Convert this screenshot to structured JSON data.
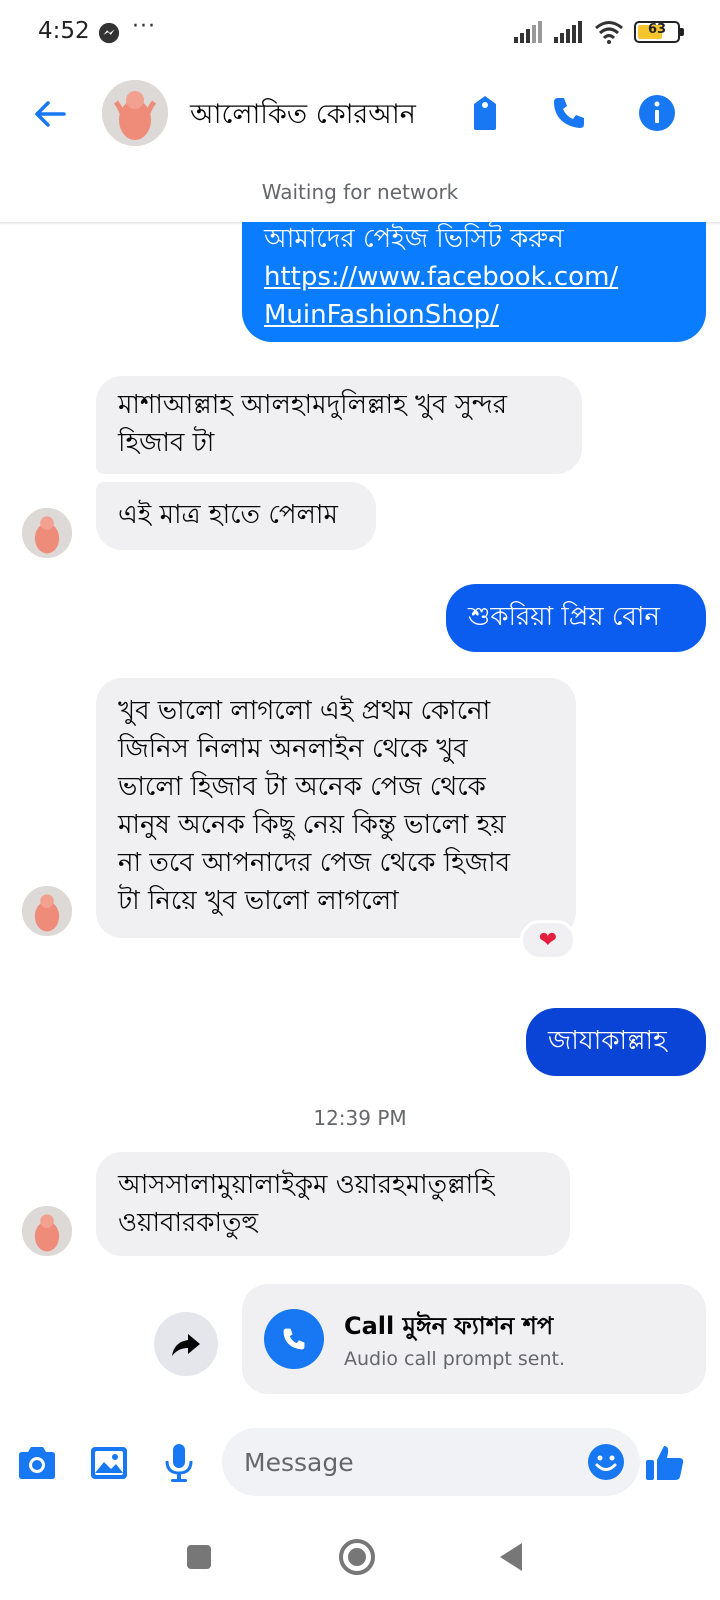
{
  "status_bar": {
    "time": "4:52",
    "dots": "···",
    "battery": "63"
  },
  "header": {
    "title": "আলোকিত কোরআন",
    "network_status": "Waiting for network"
  },
  "messages": [
    {
      "direction": "outgoing",
      "lines": [
        "আমাদের পেইজ ভিসিট করুন"
      ],
      "link_lines": [
        "https://www.facebook.com/",
        "MuinFashionShop/"
      ]
    },
    {
      "direction": "incoming",
      "lines": [
        "মাশাআল্লাহ আলহামদুলিল্লাহ খুব সুন্দর",
        "হিজাব টা"
      ]
    },
    {
      "direction": "incoming",
      "lines": [
        "এই মাত্র হাতে পেলাম"
      ]
    },
    {
      "direction": "outgoing",
      "lines": [
        "শুকরিয়া প্রিয় বোন"
      ]
    },
    {
      "direction": "incoming",
      "lines": [
        "খুব ভালো লাগলো এই প্রথম কোনো",
        "জিনিস নিলাম অনলাইন থেকে খুব",
        "ভালো হিজাব টা অনেক পেজ থেকে",
        "মানুষ অনেক কিছু নেয় কিন্তু ভালো হয়",
        "না তবে আপনাদের পেজ থেকে হিজাব",
        "টা নিয়ে খুব ভালো লাগলো"
      ],
      "reaction": "heart"
    },
    {
      "direction": "outgoing",
      "lines": [
        "জাযাকাল্লাহ"
      ]
    },
    {
      "direction": "incoming",
      "lines": [
        "আসসালামুয়ালাইকুম ওয়ারহমাতুল্লাহি",
        "ওয়াবারকাতুহু"
      ]
    }
  ],
  "timestamp": "12:39 PM",
  "call_card": {
    "title": "Call মুঈন ফ্যাশন শপ",
    "subtitle": "Audio call prompt sent."
  },
  "composer": {
    "placeholder": "Message"
  },
  "colors": {
    "accent": "#1877f2",
    "bubble_blue": "#0a7cff",
    "bubble_blue_mid": "#0b5df0",
    "bubble_blue_deep": "#0a44d6",
    "incoming_bubble": "#f0f0f3"
  },
  "icons": [
    "back-arrow-icon",
    "tag-icon",
    "phone-icon",
    "info-icon",
    "camera-icon",
    "gallery-icon",
    "microphone-icon",
    "emoji-icon",
    "thumbs-up-icon",
    "forward-icon"
  ]
}
